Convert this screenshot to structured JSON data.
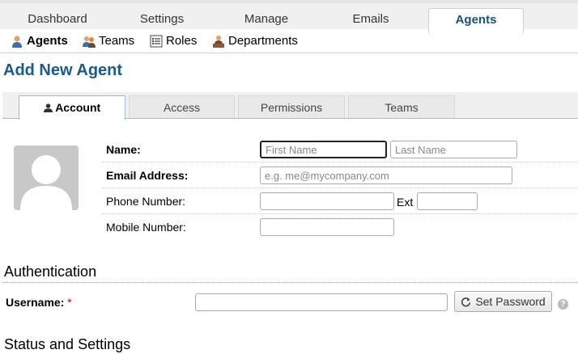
{
  "top_tabs": [
    {
      "label": "Dashboard"
    },
    {
      "label": "Settings"
    },
    {
      "label": "Manage"
    },
    {
      "label": "Emails"
    },
    {
      "label": "Agents"
    }
  ],
  "sub_nav": [
    {
      "label": "Agents",
      "icon": "agent-icon"
    },
    {
      "label": "Teams",
      "icon": "teams-icon"
    },
    {
      "label": "Roles",
      "icon": "roles-icon"
    },
    {
      "label": "Departments",
      "icon": "departments-icon"
    }
  ],
  "page_title": "Add New Agent",
  "form_tabs": [
    {
      "label": "Account",
      "icon": "user-icon"
    },
    {
      "label": "Access"
    },
    {
      "label": "Permissions"
    },
    {
      "label": "Teams"
    }
  ],
  "fields": {
    "name_label": "Name:",
    "first_name_placeholder": "First Name",
    "last_name_placeholder": "Last Name",
    "email_label": "Email Address:",
    "email_placeholder": "e.g. me@mycompany.com",
    "phone_label": "Phone Number:",
    "ext_label": "Ext",
    "mobile_label": "Mobile Number:"
  },
  "authentication": {
    "title": "Authentication",
    "username_label": "Username:",
    "required_marker": "*",
    "set_password_label": "Set Password",
    "help_glyph": "?"
  },
  "status_settings": {
    "title": "Status and Settings"
  },
  "colors": {
    "title_blue": "#1a5a8c",
    "active_tab_text": "#1a4f7a",
    "required_red": "#cc0000"
  }
}
